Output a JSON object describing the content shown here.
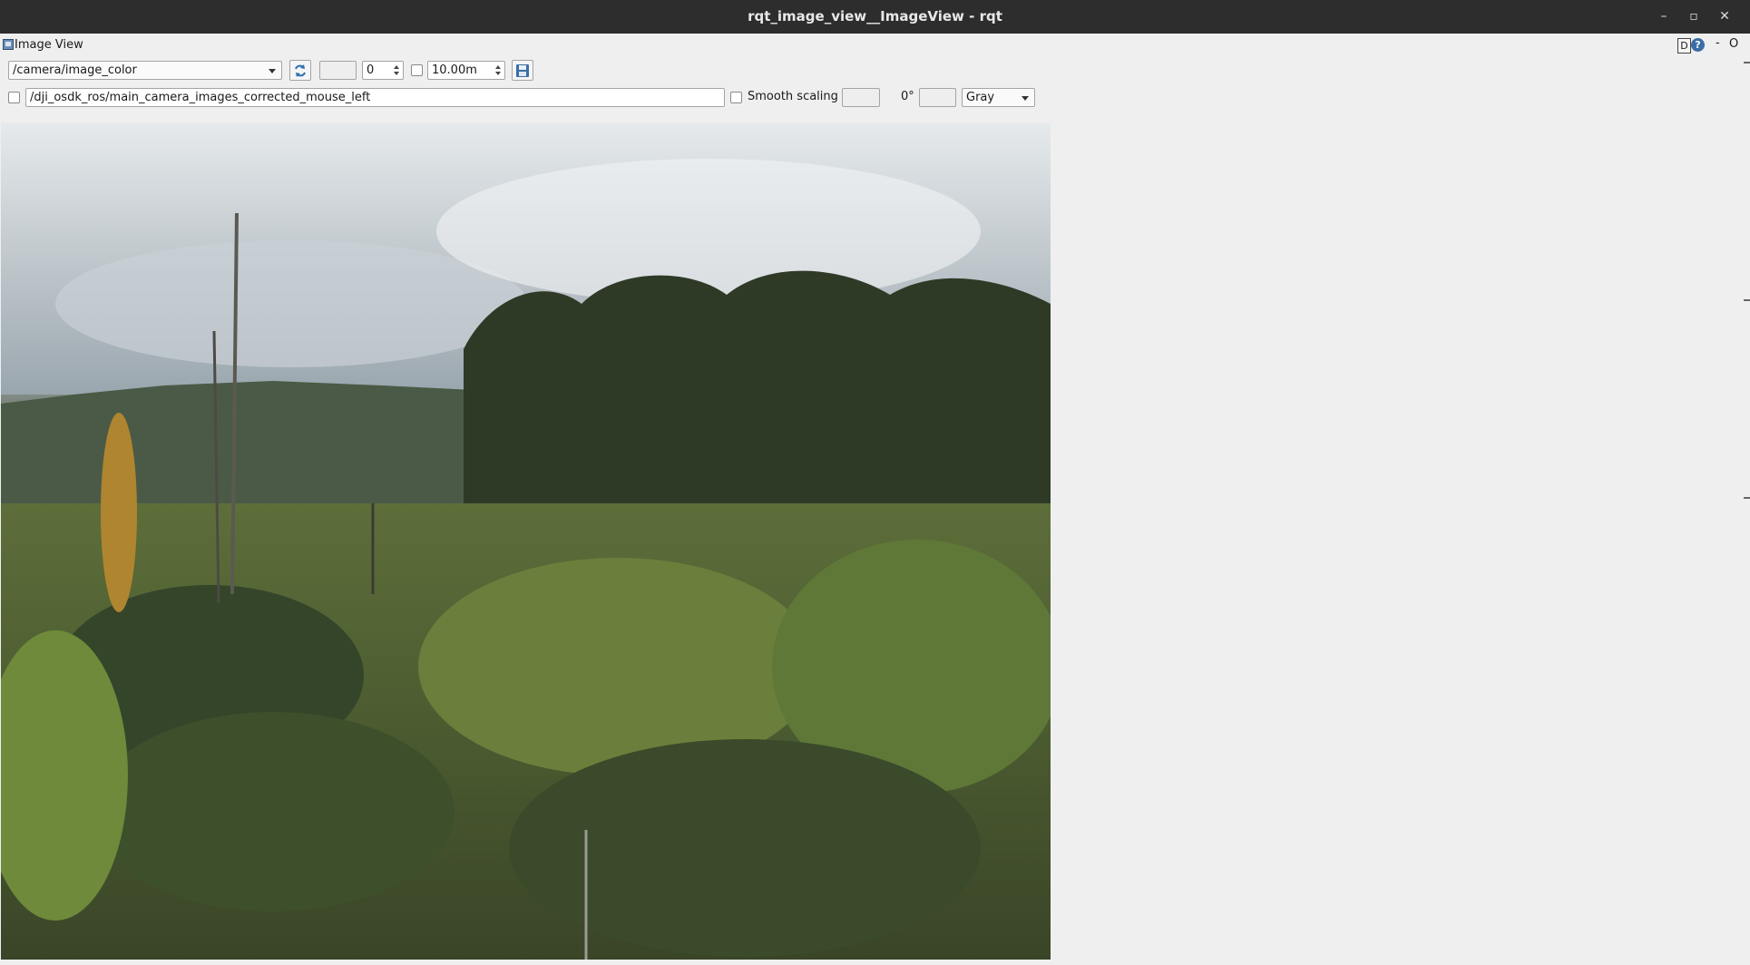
{
  "window": {
    "title": "rqt_image_view__ImageView - rqt",
    "controls": [
      "–",
      "▫",
      "✕"
    ]
  },
  "dock": {
    "title": "Image View",
    "d_label": "D",
    "help_label": "?",
    "minimize_label": "-",
    "close_label": "O"
  },
  "toolbar": {
    "topic": "/camera/image_color",
    "blank_field": "",
    "spin_value": "0",
    "spin_enabled": false,
    "time_value": "10.00m"
  },
  "toolbar2": {
    "mouse_topic_checked": false,
    "mouse_topic": "/dji_osdk_ros/main_camera_images_corrected_mouse_left",
    "smooth_scaling_checked": false,
    "smooth_scaling_label": "Smooth scaling",
    "rotation_label": "0°",
    "colormap": "Gray"
  },
  "image": {
    "description_icon": "camera-feed-image"
  }
}
